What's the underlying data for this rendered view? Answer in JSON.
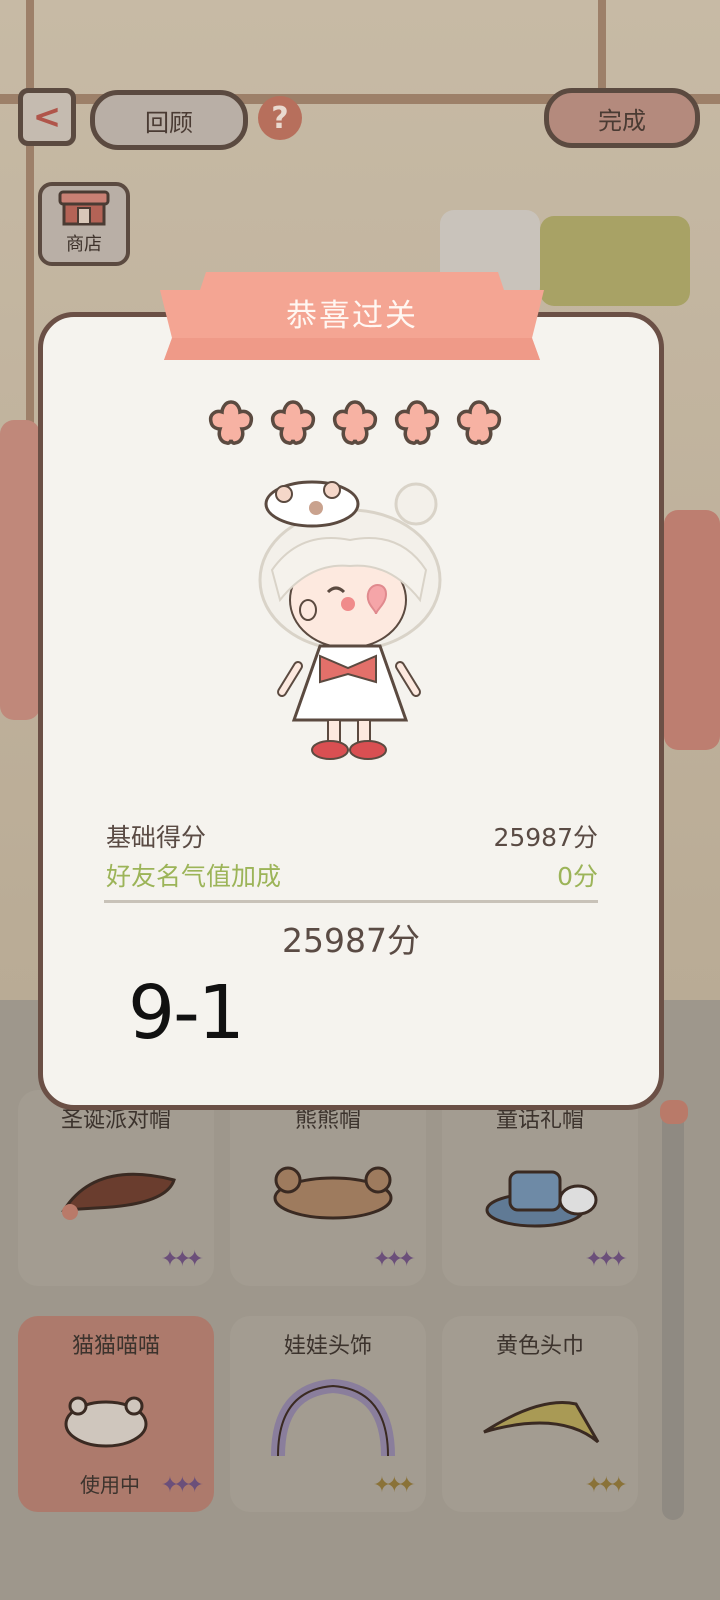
{
  "header": {
    "review_label": "回顾",
    "done_label": "完成",
    "help_glyph": "?",
    "back_glyph": "<"
  },
  "shop": {
    "label": "商店"
  },
  "modal": {
    "title": "恭喜过关",
    "star_count": 5,
    "base_score_label": "基础得分",
    "base_score_value": "25987分",
    "bonus_label": "好友名气值加成",
    "bonus_value": "0分",
    "total_value": "25987分",
    "level_text": "9-1"
  },
  "items": [
    {
      "name": "圣诞派对帽",
      "stars": "✦✦✦",
      "rarity": "purple"
    },
    {
      "name": "熊熊帽",
      "stars": "✦✦✦",
      "rarity": "purple"
    },
    {
      "name": "童话礼帽",
      "stars": "✦✦✦",
      "rarity": "purple"
    },
    {
      "name": "猫猫喵喵",
      "stars": "✦✦✦",
      "rarity": "purple",
      "status": "使用中"
    },
    {
      "name": "娃娃头饰",
      "stars": "✦✦✦",
      "rarity": "gold"
    },
    {
      "name": "黄色头巾",
      "stars": "✦✦✦",
      "rarity": "gold"
    }
  ],
  "colors": {
    "accent": "#f4a593",
    "modal_bg": "#f5f3ee",
    "bonus_green": "#9cb458",
    "border_brown": "#6b5046"
  }
}
